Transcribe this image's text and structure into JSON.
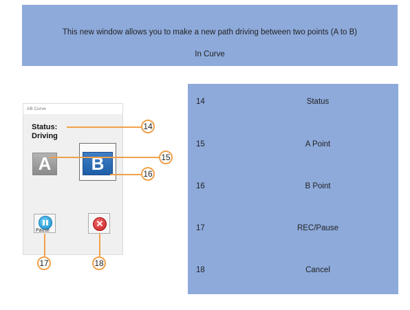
{
  "banner": {
    "line1": "This new window allows you to make a new path driving between two points (A to B)",
    "line2": "In Curve"
  },
  "screenshot": {
    "window_title": "AB Curve",
    "status_label": "Status:",
    "status_value": "Driving",
    "a_button": "A",
    "b_button": "B",
    "pause_label": "Pause"
  },
  "callouts": [
    "14",
    "15",
    "16",
    "17",
    "18"
  ],
  "legend": [
    {
      "num": "14",
      "label": "Status"
    },
    {
      "num": "15",
      "label": "A Point"
    },
    {
      "num": "16",
      "label": "B Point"
    },
    {
      "num": "17",
      "label": "REC/Pause"
    },
    {
      "num": "18",
      "label": "Cancel"
    }
  ],
  "colors": {
    "panel": "#8eaadb",
    "callout": "#f0a04a"
  }
}
